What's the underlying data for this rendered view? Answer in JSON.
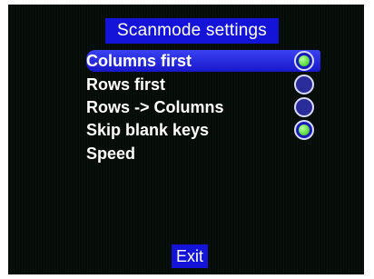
{
  "header": {
    "title": "Scanmode settings"
  },
  "menu": {
    "items": [
      {
        "label": "Columns first",
        "checked": true,
        "selected": true
      },
      {
        "label": "Rows first",
        "checked": false
      },
      {
        "label": "Rows -> Columns",
        "checked": false
      },
      {
        "label": "Skip blank keys",
        "checked": true
      },
      {
        "label": "Speed"
      }
    ]
  },
  "footer": {
    "exit_label": "Exit"
  },
  "colors": {
    "background": "#050b07",
    "title_bar": "#1414d8",
    "selection": "#2b2ff0",
    "radio_checked": "#56d83f"
  }
}
